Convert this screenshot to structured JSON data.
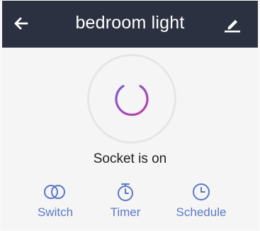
{
  "header": {
    "title": "bedroom light"
  },
  "device": {
    "status_text": "Socket is on"
  },
  "actions": [
    {
      "label": "Switch",
      "icon": "switch-toggle-icon"
    },
    {
      "label": "Timer",
      "icon": "timer-icon"
    },
    {
      "label": "Schedule",
      "icon": "schedule-clock-icon"
    }
  ],
  "colors": {
    "header_bg": "#2c3142",
    "accent": "#5a79c7",
    "power_gradient_start": "#7b5bd6",
    "power_gradient_end": "#c23fa0"
  }
}
